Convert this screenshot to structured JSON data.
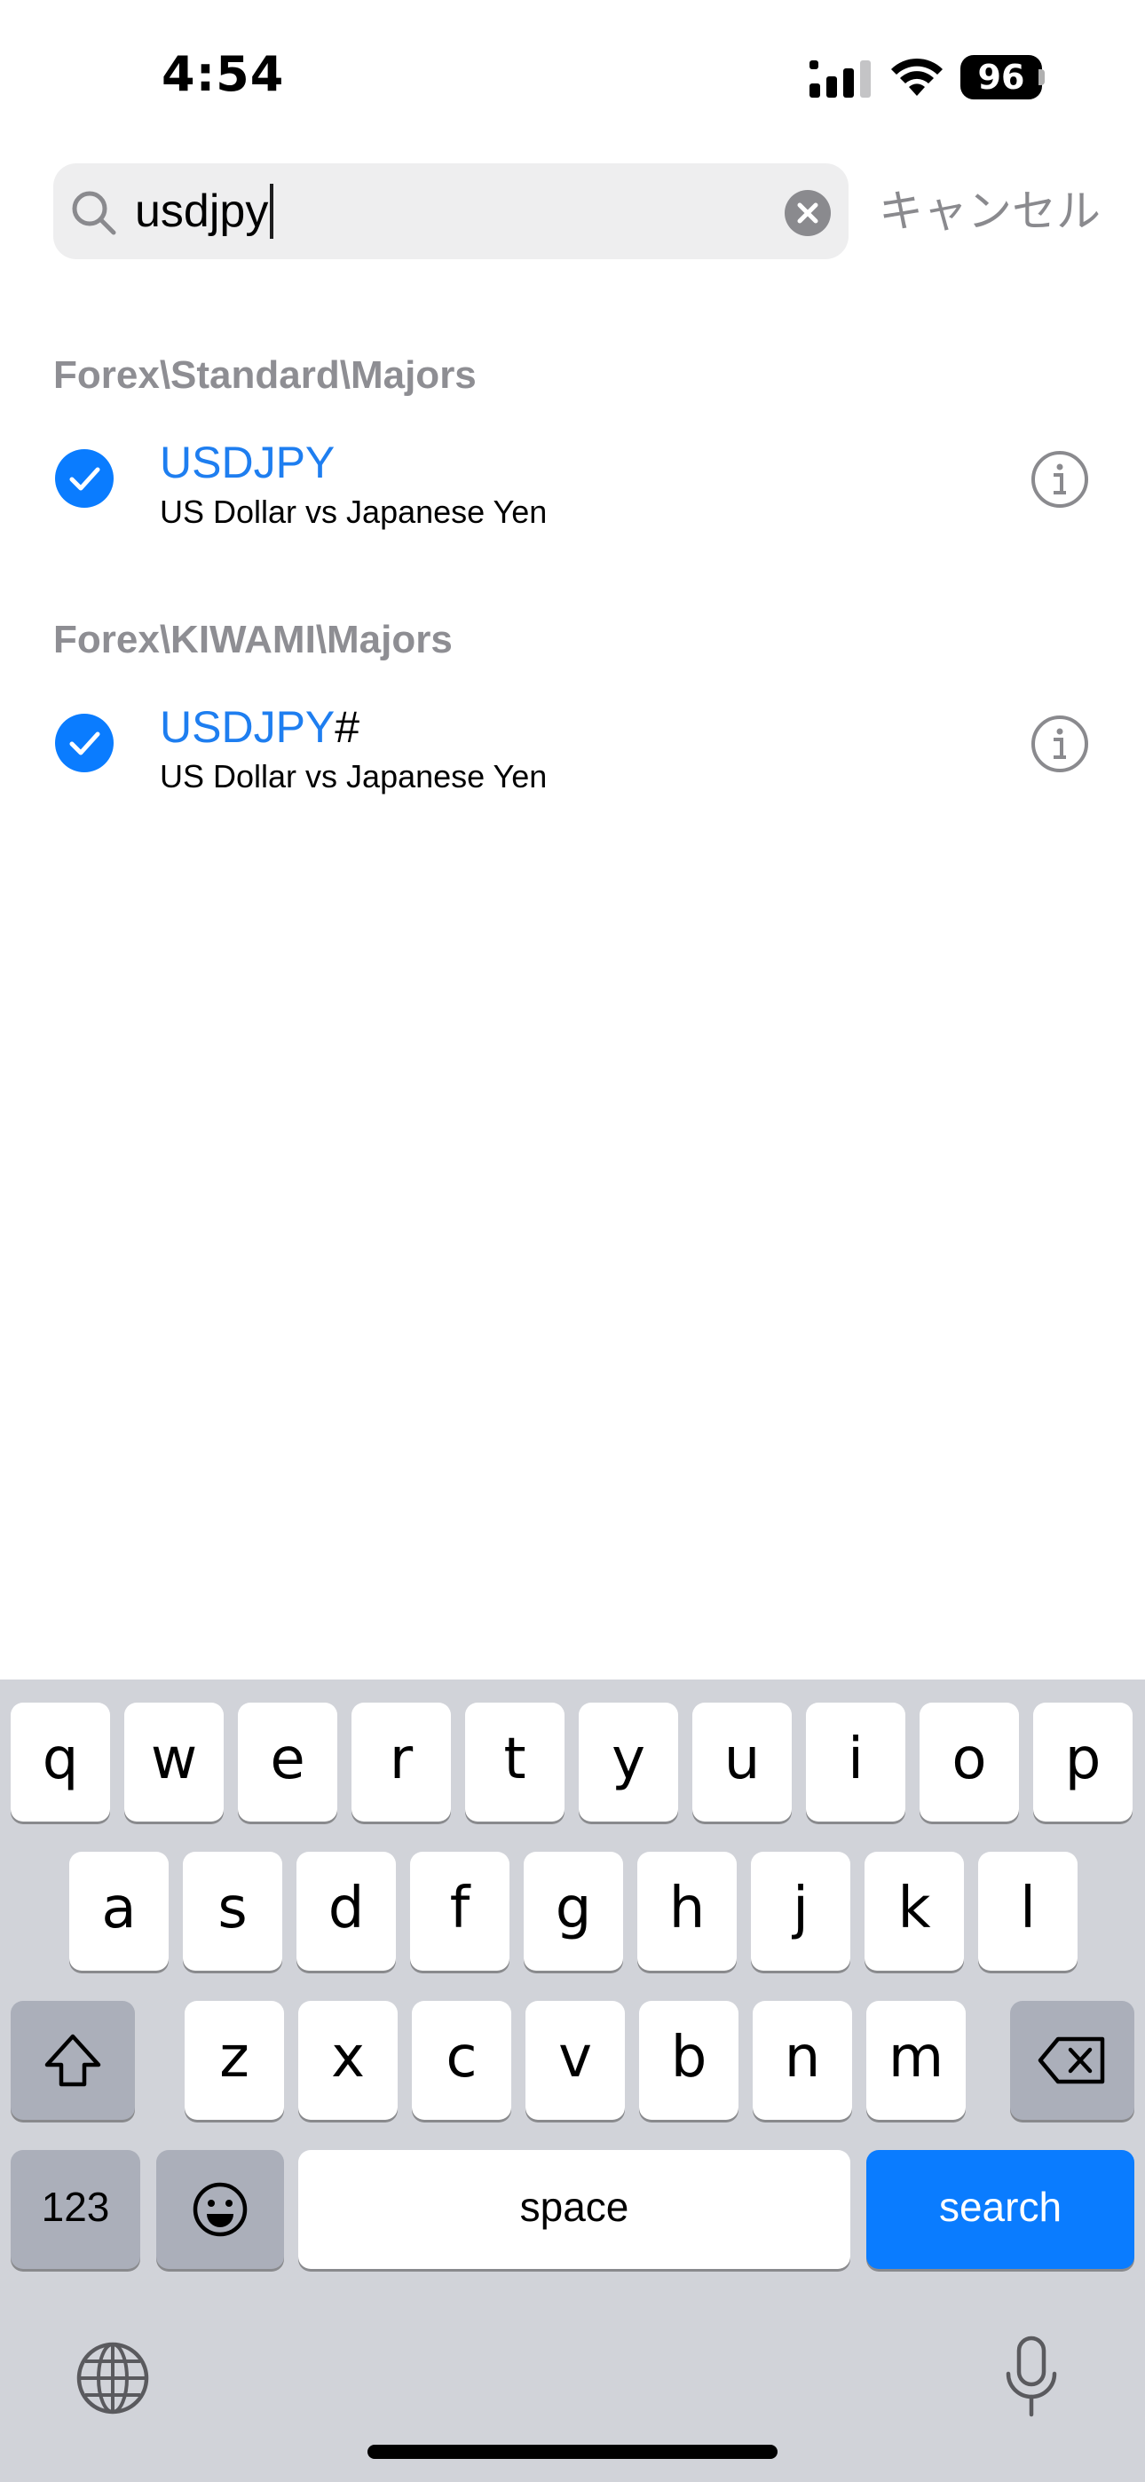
{
  "status": {
    "time": "4:54",
    "battery": "96"
  },
  "search": {
    "query": "usdjpy",
    "cancel_label": "キャンセル"
  },
  "results": [
    {
      "group": "Forex\\Standard\\Majors",
      "symbol": "USDJPY",
      "suffix": "",
      "description": "US Dollar vs Japanese Yen"
    },
    {
      "group": "Forex\\KIWAMI\\Majors",
      "symbol": "USDJPY",
      "suffix": "#",
      "description": "US Dollar vs Japanese Yen"
    }
  ],
  "keyboard": {
    "row1": [
      "q",
      "w",
      "e",
      "r",
      "t",
      "y",
      "u",
      "i",
      "o",
      "p"
    ],
    "row2": [
      "a",
      "s",
      "d",
      "f",
      "g",
      "h",
      "j",
      "k",
      "l"
    ],
    "row3": [
      "z",
      "x",
      "c",
      "v",
      "b",
      "n",
      "m"
    ],
    "numbers_label": "123",
    "space_label": "space",
    "search_label": "search"
  },
  "colors": {
    "accent": "#0a7cff",
    "symbol_blue": "#1e7ef0",
    "keyboard_bg": "#d1d3d9"
  }
}
